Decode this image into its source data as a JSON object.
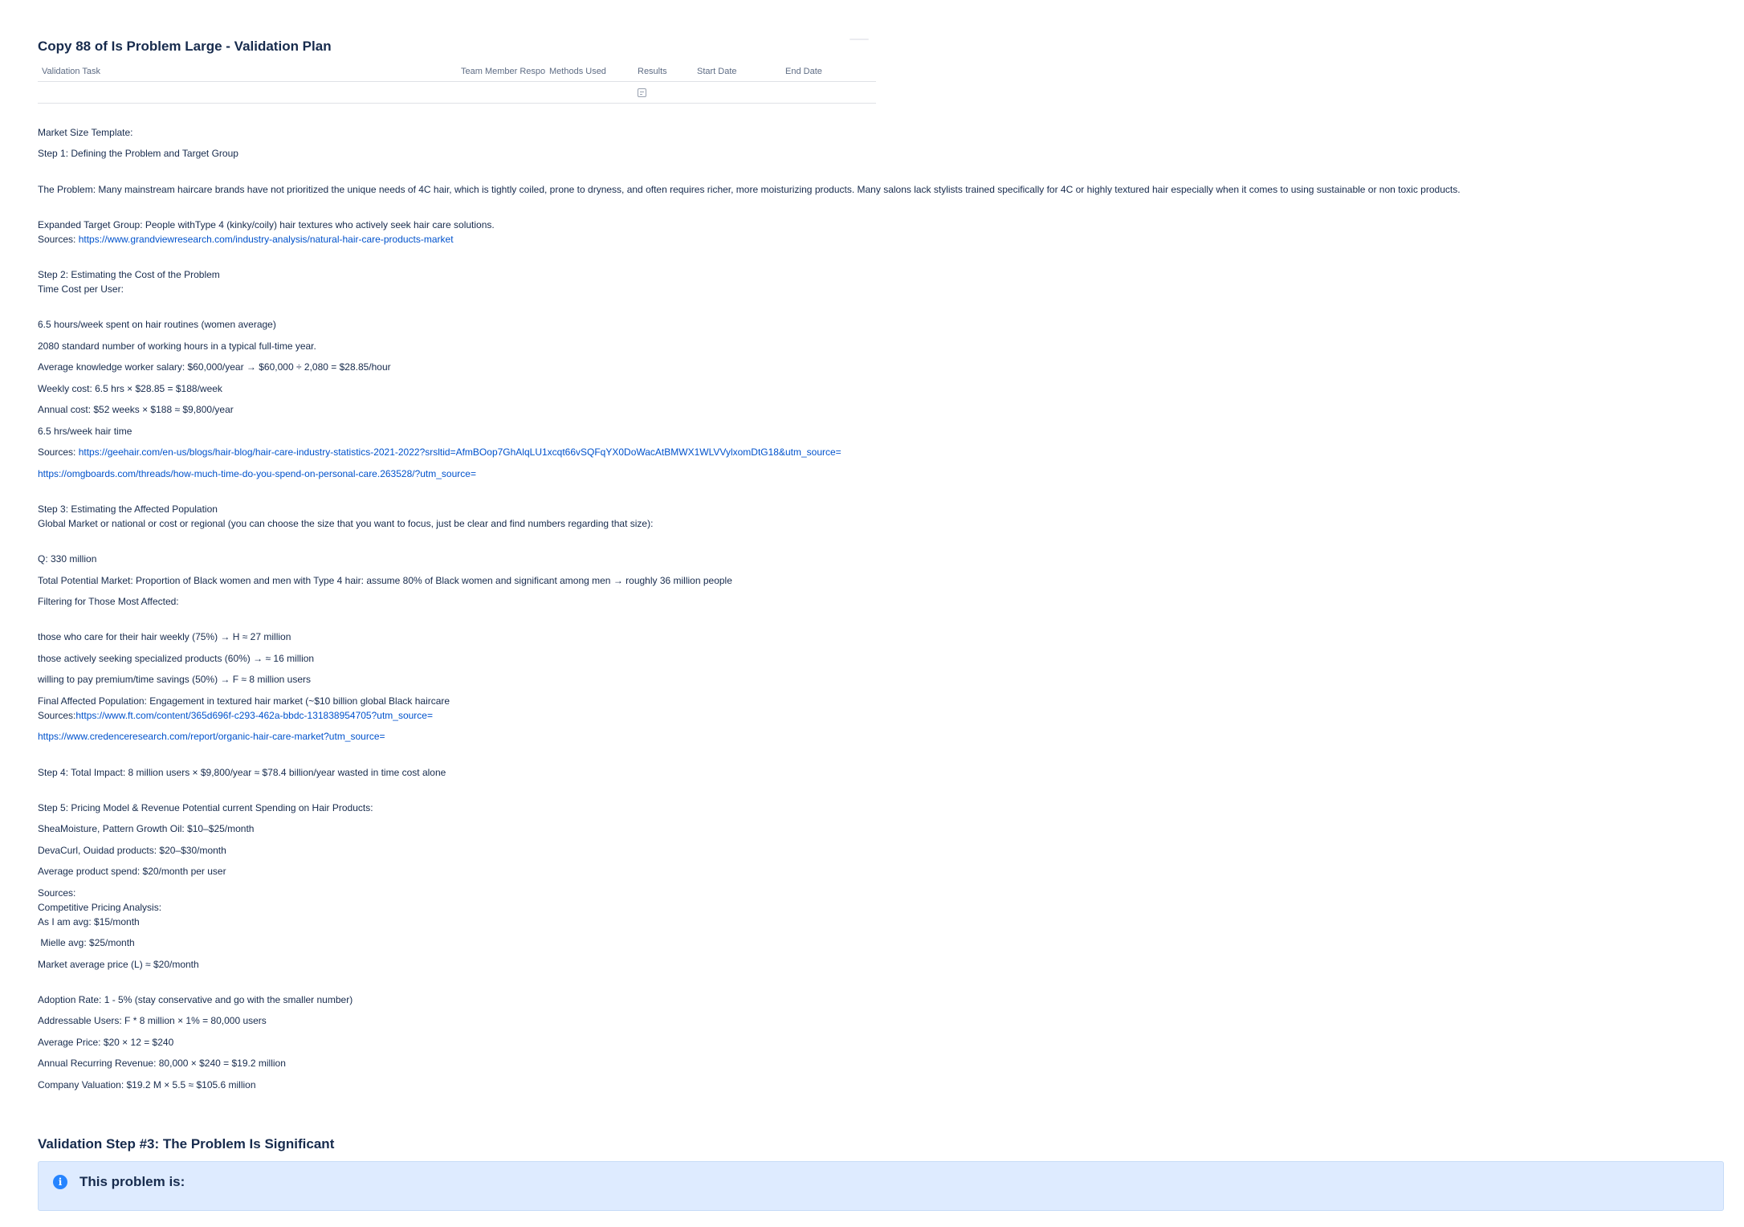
{
  "plan": {
    "title": "Copy 88 of Is Problem Large - Validation Plan",
    "columns": {
      "task": "Validation Task",
      "team": "Team Member Respo",
      "methods": "Methods Used",
      "results": "Results",
      "start": "Start Date",
      "end": "End Date"
    }
  },
  "content": {
    "market_size_template": "Market Size Template:",
    "step1_title": "Step 1: Defining the Problem and Target Group",
    "problem": "The Problem: Many mainstream haircare brands have not prioritized the unique needs of 4C hair, which is tightly coiled, prone to dryness, and often requires richer, more moisturizing products. Many salons lack stylists trained specifically for 4C or highly textured hair especially when it comes to using sustainable or non toxic products.",
    "target_group": "Expanded Target Group: People withType 4 (kinky/coily) hair textures who actively seek hair care solutions.",
    "sources1_label": "Sources: ",
    "sources1_link": "https://www.grandviewresearch.com/industry-analysis/natural-hair-care-products-market",
    "step2_title": "Step 2: Estimating the Cost of the Problem",
    "time_cost": "Time Cost per User:",
    "hours_week": "6.5 hours/week spent on hair routines (women average)",
    "working_hours": "2080 standard number of working hours in a typical full-time year.",
    "avg_salary": "Average knowledge worker salary: $60,000/year → $60,000 ÷ 2,080 = $28.85/hour",
    "weekly_cost": "Weekly cost: 6.5 hrs × $28.85 = $188/week",
    "annual_cost": "Annual cost: $52 weeks × $188 ≈ $9,800/year",
    "hair_time": "6.5 hrs/week hair time",
    "sources2_label": "Sources:  ",
    "sources2_link": "https://geehair.com/en-us/blogs/hair-blog/hair-care-industry-statistics-2021-2022?srsltid=AfmBOop7GhAlqLU1xcqt66vSQFqYX0DoWacAtBMWX1WLVVylxomDtG18&utm_source=",
    "sources2_link_b": "https://omgboards.com/threads/how-much-time-do-you-spend-on-personal-care.263528/?utm_source=",
    "step3_title": "Step 3: Estimating the Affected Population",
    "global_market": "Global Market or national or cost or regional (you can choose the size that you want to focus, just be clear and find numbers regarding that size):",
    "q_value": "Q: 330 million",
    "total_potential": "Total Potential Market: Proportion of Black women and men with Type 4 hair: assume 80% of Black women and significant among men → roughly 36 million people",
    "filtering": "Filtering for Those Most Affected:",
    "care_weekly": "those who care for their hair weekly (75%) → H ≈ 27 million",
    "seeking": "those actively seeking specialized products (60%) → ≈ 16 million",
    "willing": "willing to pay premium/time savings (50%) → F ≈ 8 million users",
    "final_affected": "Final Affected Population: Engagement in textured hair market (~$10 billion global Black haircare",
    "sources3_label": "Sources:",
    "sources3_link": "https://www.ft.com/content/365d696f-c293-462a-bbdc-131838954705?utm_source=",
    "sources3_link_b": "https://www.credenceresearch.com/report/organic-hair-care-market?utm_source=",
    "step4": "Step 4: Total Impact: 8 million users × $9,800/year ≈ $78.4 billion/year wasted in time cost alone",
    "step5_title": "Step 5: Pricing Model & Revenue Potential current Spending on Hair Products:",
    "sheamoisture": "SheaMoisture, Pattern Growth Oil: $10–$25/month",
    "devacurl": "DevaCurl, Ouidad products: $20–$30/month",
    "avg_spend": "Average product spend: $20/month per user",
    "sources4": "Sources:",
    "competitive": "Competitive Pricing Analysis:",
    "as_i_am": "As I am avg: $15/month",
    "mielle": " Mielle avg: $25/month",
    "market_avg": "Market average price (L) ≈ $20/month",
    "adoption": "Adoption Rate: 1 - 5% (stay conservative and go with the smaller number)",
    "addressable": "Addressable Users: F * 8 million × 1% = 80,000 users",
    "avg_price": "Average Price: $20 × 12 = $240",
    "arr": "Annual Recurring Revenue: 80,000 × $240 = $19.2 million",
    "valuation": "Company Valuation: $19.2 M × 5.5 ≈ $105.6 million"
  },
  "validation": {
    "heading": "Validation Step #3: The Problem Is Significant",
    "panel_icon": "info-icon",
    "panel_text": "This problem is:"
  },
  "colors": {
    "text": "#172b4d",
    "link": "#0052cc",
    "panel_bg": "#deebff",
    "info_icon": "#2684ff"
  }
}
